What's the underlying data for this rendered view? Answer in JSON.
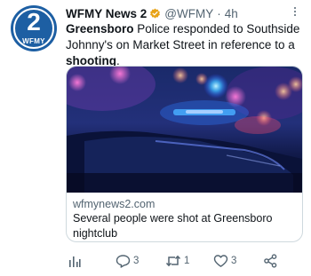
{
  "account": {
    "name": "WFMY News 2",
    "handle": "@WFMY",
    "separator": "·",
    "time": "4h",
    "avatar_number": "2",
    "avatar_callsign": "WFMY"
  },
  "tweet": {
    "text_bold_1": "Greensboro",
    "text_middle": " Police responded to Southside Johnny's on Market Street in reference to a ",
    "text_bold_2": "shooting",
    "text_end": "."
  },
  "card": {
    "domain": "wfmynews2.com",
    "title": "Several people were shot at Greensboro nightclub"
  },
  "actions": {
    "replies": "3",
    "retweets": "1",
    "likes": "3"
  },
  "colors": {
    "brand": "#1d5fa3",
    "verified": "#e8a317",
    "muted": "#536471"
  },
  "icons": [
    "verified-badge-icon",
    "more-icon",
    "analytics-icon",
    "reply-icon",
    "retweet-icon",
    "like-icon",
    "share-icon"
  ]
}
